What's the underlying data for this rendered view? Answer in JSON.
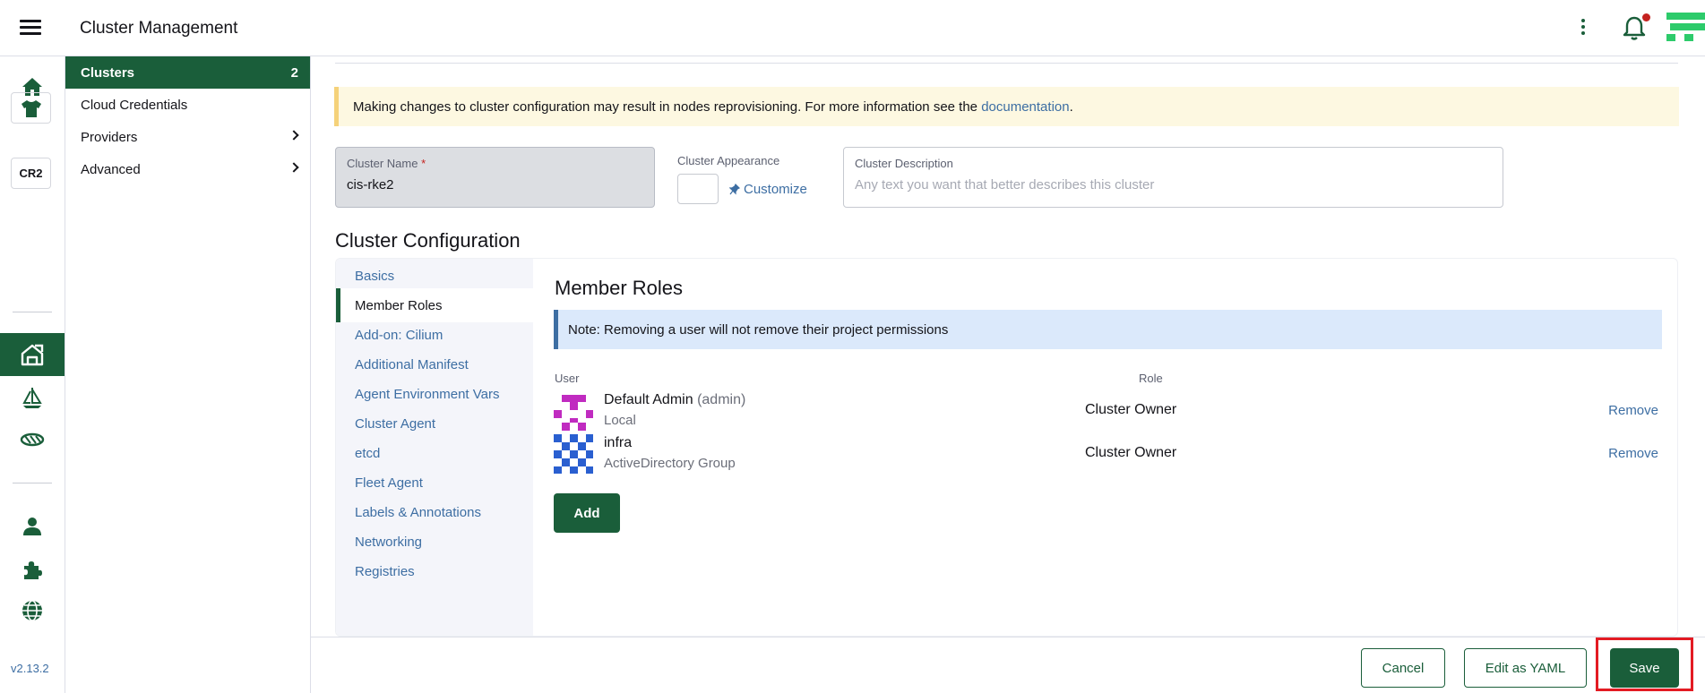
{
  "header": {
    "title": "Cluster Management"
  },
  "rail": {
    "cluster_badge": "CR2",
    "version": "v2.13.2"
  },
  "sidenav": {
    "items": [
      {
        "label": "Clusters",
        "count": "2"
      },
      {
        "label": "Cloud Credentials"
      },
      {
        "label": "Providers"
      },
      {
        "label": "Advanced"
      }
    ]
  },
  "banner": {
    "text": "Making changes to cluster configuration may result in nodes reprovisioning. For more information see the ",
    "link": "documentation",
    "suffix": "."
  },
  "form": {
    "name_label": "Cluster Name",
    "name_required": "*",
    "name_value": "cis-rke2",
    "appearance_label": "Cluster Appearance",
    "customize_label": "Customize",
    "description_label": "Cluster Description",
    "description_placeholder": "Any text you want that better describes this cluster"
  },
  "config": {
    "title": "Cluster Configuration",
    "tabs": [
      "Basics",
      "Member Roles",
      "Add-on: Cilium",
      "Additional Manifest",
      "Agent Environment Vars",
      "Cluster Agent",
      "etcd",
      "Fleet Agent",
      "Labels & Annotations",
      "Networking",
      "Registries"
    ],
    "active_tab": "Member Roles"
  },
  "member_roles": {
    "title": "Member Roles",
    "note": "Note: Removing a user will not remove their project permissions",
    "columns": {
      "user": "User",
      "role": "Role"
    },
    "rows": [
      {
        "name": "Default Admin",
        "sub": "(admin)",
        "provider": "Local",
        "role": "Cluster Owner",
        "action": "Remove"
      },
      {
        "name": "infra",
        "sub": "",
        "provider": "ActiveDirectory Group",
        "role": "Cluster Owner",
        "action": "Remove"
      }
    ],
    "add_label": "Add"
  },
  "footer": {
    "cancel": "Cancel",
    "edit_yaml": "Edit as YAML",
    "save": "Save"
  },
  "colors": {
    "primary": "#1a5e3a",
    "link": "#3d6ea3",
    "highlight": "#e31b23"
  }
}
